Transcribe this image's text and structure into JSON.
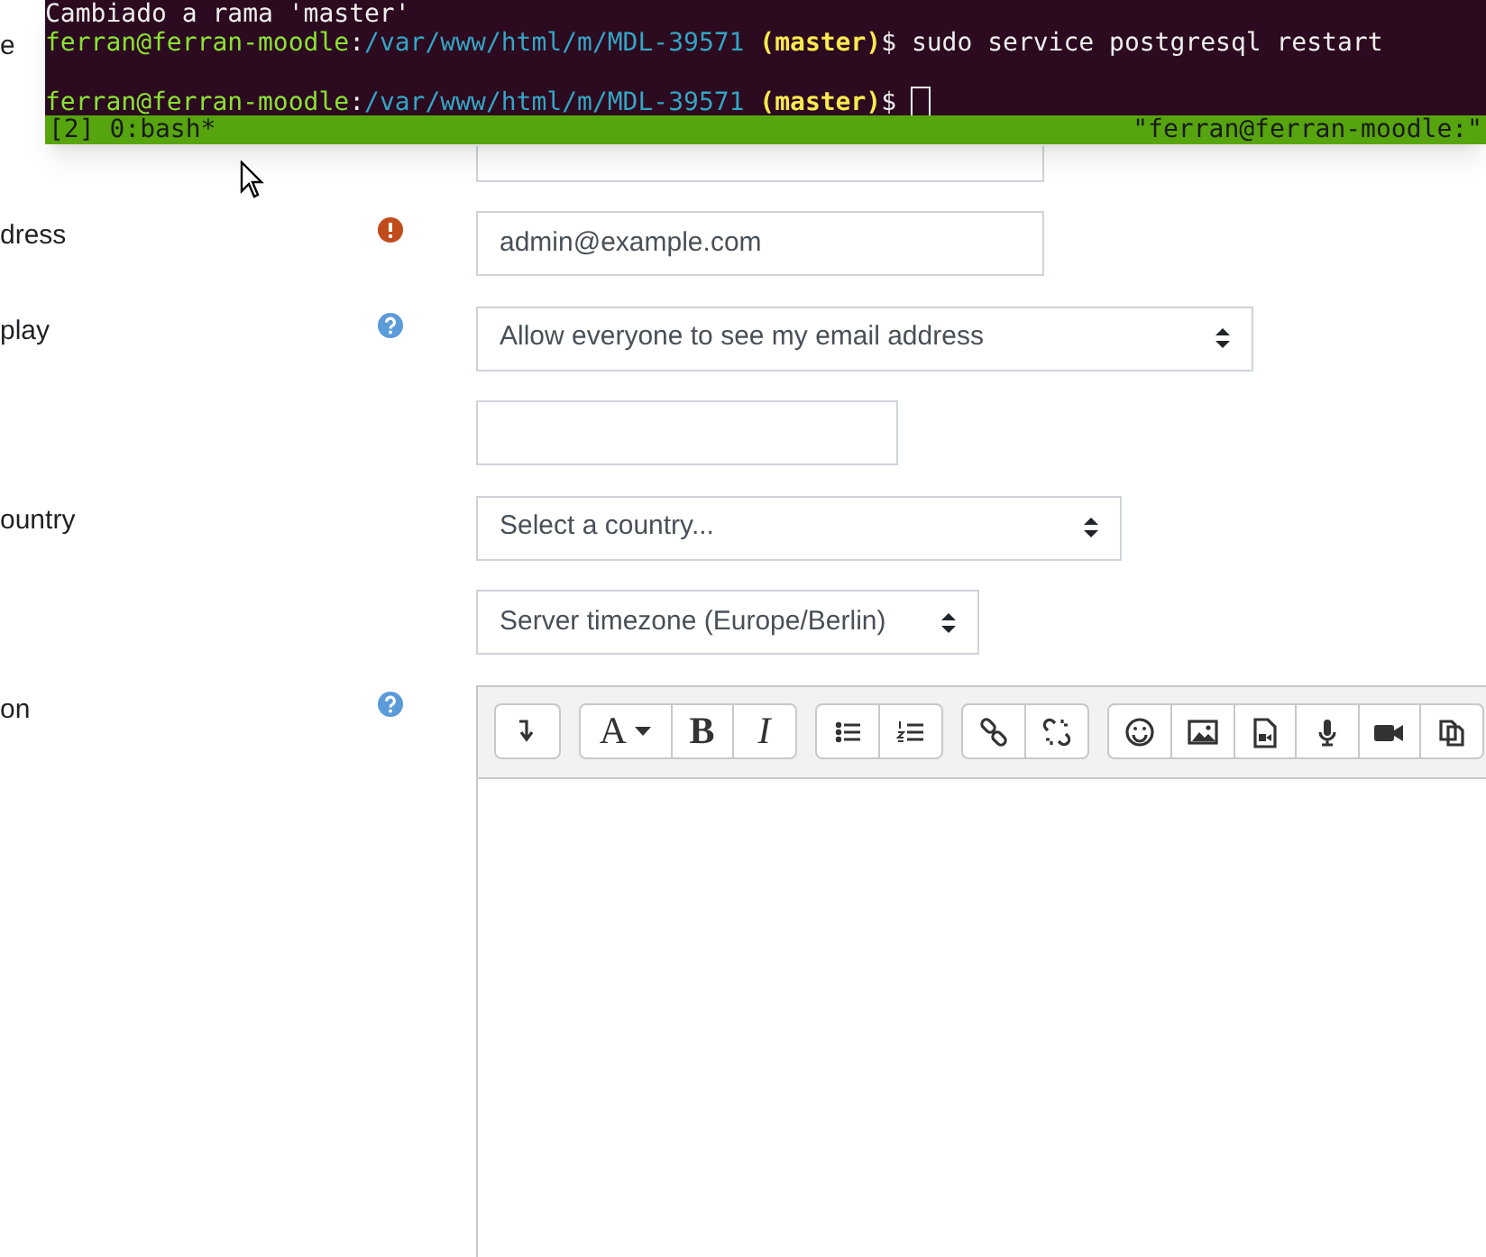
{
  "terminal": {
    "lines": [
      {
        "segments": [
          {
            "kind": "plain",
            "text": "Cambiado a rama 'master'"
          }
        ]
      },
      {
        "segments": [
          {
            "kind": "user",
            "text": "ferran@ferran-moodle"
          },
          {
            "kind": "plain",
            "text": ":"
          },
          {
            "kind": "path",
            "text": "/var/www/html/m/MDL-39571"
          },
          {
            "kind": "branch",
            "text": " (master)"
          },
          {
            "kind": "plain",
            "text": "$ sudo service postgresql restart"
          }
        ]
      },
      {
        "gap_before": true,
        "segments": [
          {
            "kind": "user",
            "text": "ferran@ferran-moodle"
          },
          {
            "kind": "plain",
            "text": ":"
          },
          {
            "kind": "path",
            "text": "/var/www/html/m/MDL-39571"
          },
          {
            "kind": "branch",
            "text": " (master)"
          },
          {
            "kind": "plain",
            "text": "$"
          },
          {
            "kind": "cursor"
          }
        ]
      }
    ],
    "status_left": "[2] 0:bash*",
    "status_right": "\"ferran@ferran-moodle:\""
  },
  "form": {
    "rows": [
      {
        "label": "e",
        "kind": "plain"
      },
      {
        "kind": "plain",
        "field": {
          "kind": "text"
        }
      },
      {
        "label": "dress",
        "kind": "error",
        "field": {
          "kind": "text",
          "value": "admin@example.com"
        }
      },
      {
        "label": "play",
        "kind": "help",
        "field": {
          "kind": "select",
          "value": "Allow everyone to see my email address"
        }
      },
      {
        "kind": "plain",
        "field": {
          "kind": "text"
        }
      },
      {
        "label": "ountry",
        "kind": "plain",
        "field": {
          "kind": "select",
          "value": "Select a country..."
        }
      },
      {
        "kind": "plain",
        "field": {
          "kind": "select",
          "value": "Server timezone (Europe/Berlin)"
        }
      }
    ],
    "editor": {
      "label": "on",
      "kind": "help",
      "toolbar": [
        [
          {
            "kind": "collapse"
          }
        ],
        [
          {
            "kind": "font",
            "label": "A"
          },
          {
            "kind": "bold",
            "label": "B"
          },
          {
            "kind": "italic",
            "label": "I"
          }
        ],
        [
          {
            "kind": "bullets"
          },
          {
            "kind": "numbers"
          }
        ],
        [
          {
            "kind": "link"
          },
          {
            "kind": "unlink"
          }
        ],
        [
          {
            "kind": "emoji"
          },
          {
            "kind": "image"
          },
          {
            "kind": "media"
          },
          {
            "kind": "mic"
          },
          {
            "kind": "video"
          },
          {
            "kind": "copy"
          }
        ]
      ]
    }
  }
}
